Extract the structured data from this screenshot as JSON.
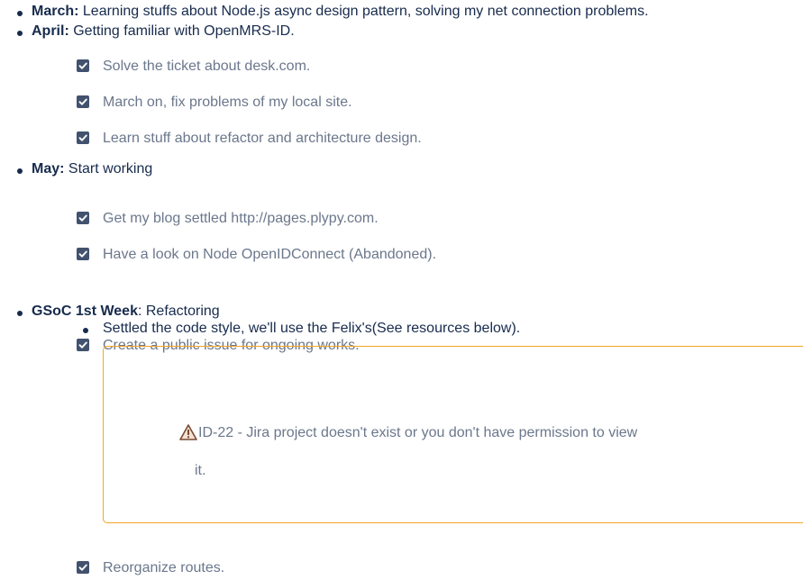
{
  "items": {
    "march": {
      "label": "March:",
      "text": " Learning stuffs about Node.js async design pattern, solving my net connection problems."
    },
    "april": {
      "label": "April:",
      "text": " Getting familiar with OpenMRS-ID.",
      "tasks": [
        "Solve the ticket about desk.com.",
        "March on, fix problems of my local site.",
        "Learn stuff about refactor and architecture design."
      ]
    },
    "may": {
      "label": "May:",
      "text": " Start working",
      "tasks": [
        "Get my blog settled http://pages.plypy.com.",
        "Have a look on Node OpenIDConnect (Abandoned)."
      ]
    },
    "gsoc": {
      "label": "GSoC 1st Week",
      "text": ": Refactoring",
      "sub_bullet": "Settled the code style, we'll use the Felix's(See resources below).",
      "tasks": [
        "Create a public issue for ongoing works.",
        "Reorganize routes."
      ],
      "jira": {
        "line1": " ID-22 - Jira project doesn't exist or you don't have permission to view",
        "line2": "it.",
        "icon": "warning-icon",
        "border_color": "#f5a623"
      }
    }
  },
  "colors": {
    "text": "#172b4d",
    "task_text": "#6b778c",
    "checkbox": "#42526e"
  }
}
